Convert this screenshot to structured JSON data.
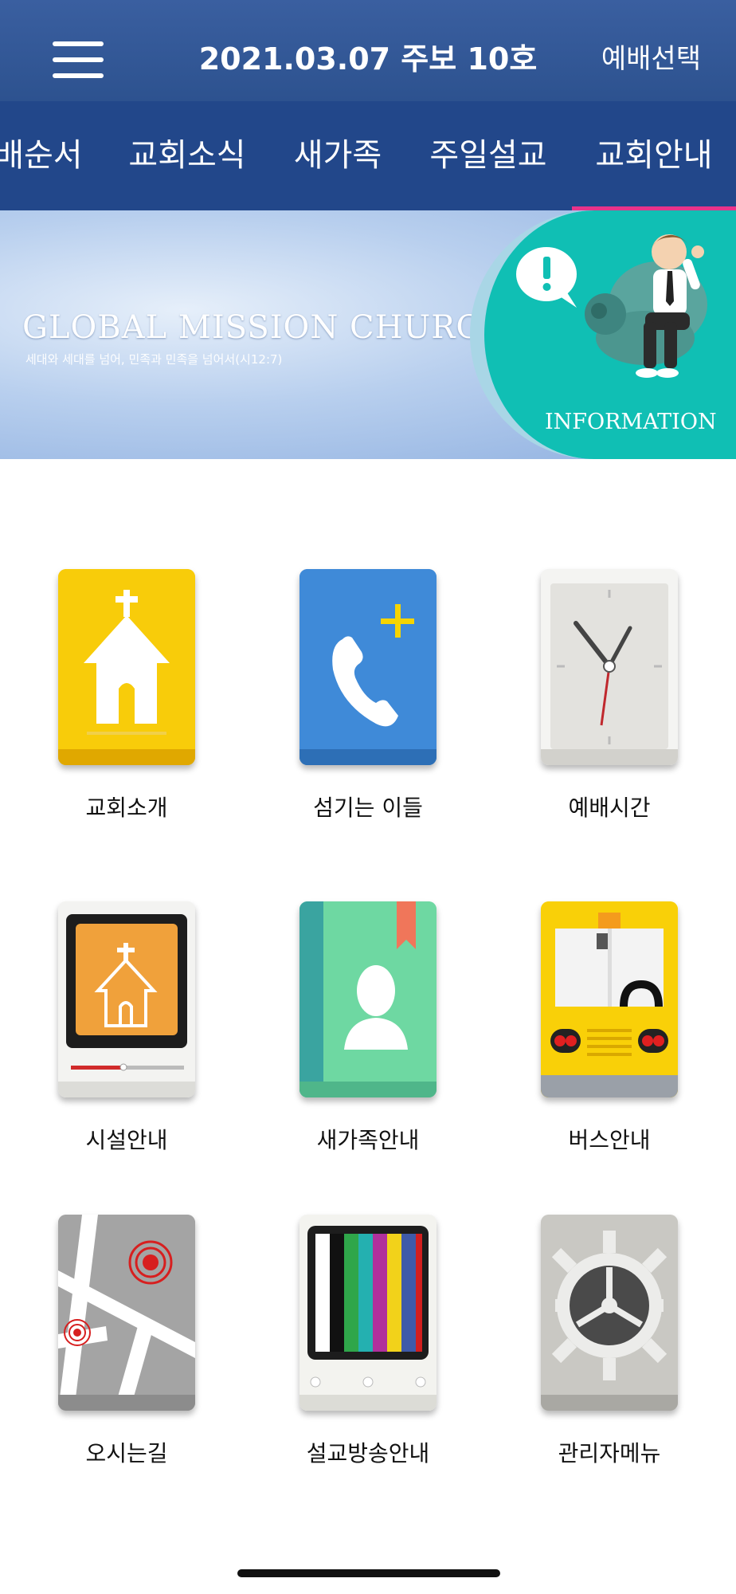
{
  "header": {
    "title": "2021.03.07 주보 10호",
    "select_label": "예배선택"
  },
  "tabs": [
    {
      "label": "예배순서"
    },
    {
      "label": "교회소식"
    },
    {
      "label": "새가족"
    },
    {
      "label": "주일설교"
    },
    {
      "label": "교회안내",
      "active": true
    }
  ],
  "banner": {
    "title": "GLOBAL MISSION CHURCH",
    "subtitle": "세대와 세대를 넘어, 민족과 민족을 넘어서(시12:7)",
    "info_label": "INFORMATION"
  },
  "menu": [
    {
      "label": "교회소개",
      "icon": "church-icon"
    },
    {
      "label": "섬기는 이들",
      "icon": "phone-plus-icon"
    },
    {
      "label": "예배시간",
      "icon": "clock-icon"
    },
    {
      "label": "시설안내",
      "icon": "facility-icon"
    },
    {
      "label": "새가족안내",
      "icon": "contact-book-icon"
    },
    {
      "label": "버스안내",
      "icon": "bus-icon"
    },
    {
      "label": "오시는길",
      "icon": "map-icon"
    },
    {
      "label": "설교방송안내",
      "icon": "tv-icon"
    },
    {
      "label": "관리자메뉴",
      "icon": "settings-gear-icon"
    }
  ],
  "colors": {
    "header_bg": "#2d528f",
    "tab_bg": "#22478a",
    "tab_underline": "#e8338a"
  }
}
